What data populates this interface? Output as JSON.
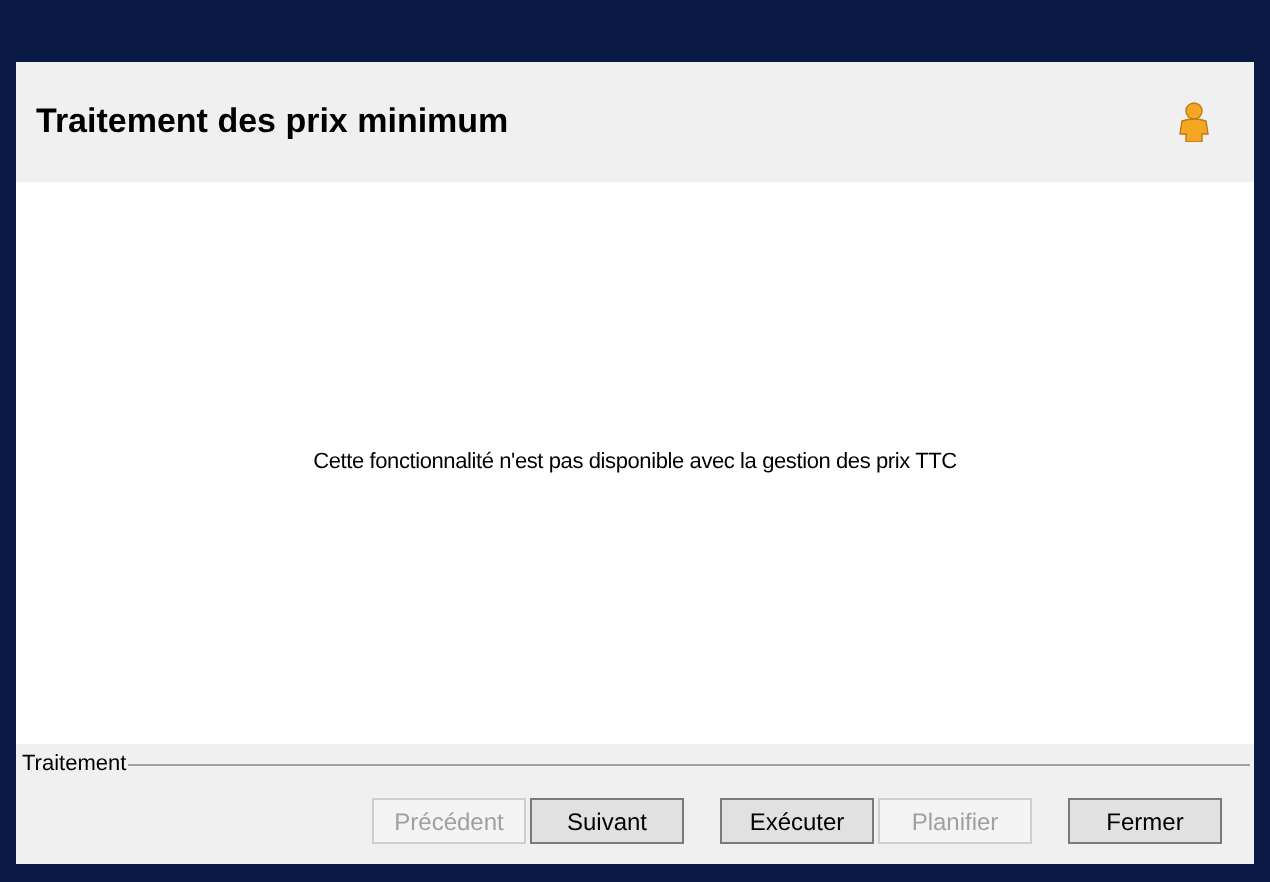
{
  "window": {
    "title": "Traitement des prix minimum"
  },
  "message": "Cette fonctionnalité n'est pas disponible avec la gestion des prix TTC",
  "footer": {
    "group_label": "Traitement"
  },
  "buttons": [
    {
      "label": "Précédent",
      "disabled": true
    },
    {
      "label": "Suivant",
      "disabled": false
    },
    {
      "label": "Exécuter",
      "disabled": false
    },
    {
      "label": "Planifier",
      "disabled": true
    },
    {
      "label": "Fermer",
      "disabled": false
    }
  ]
}
